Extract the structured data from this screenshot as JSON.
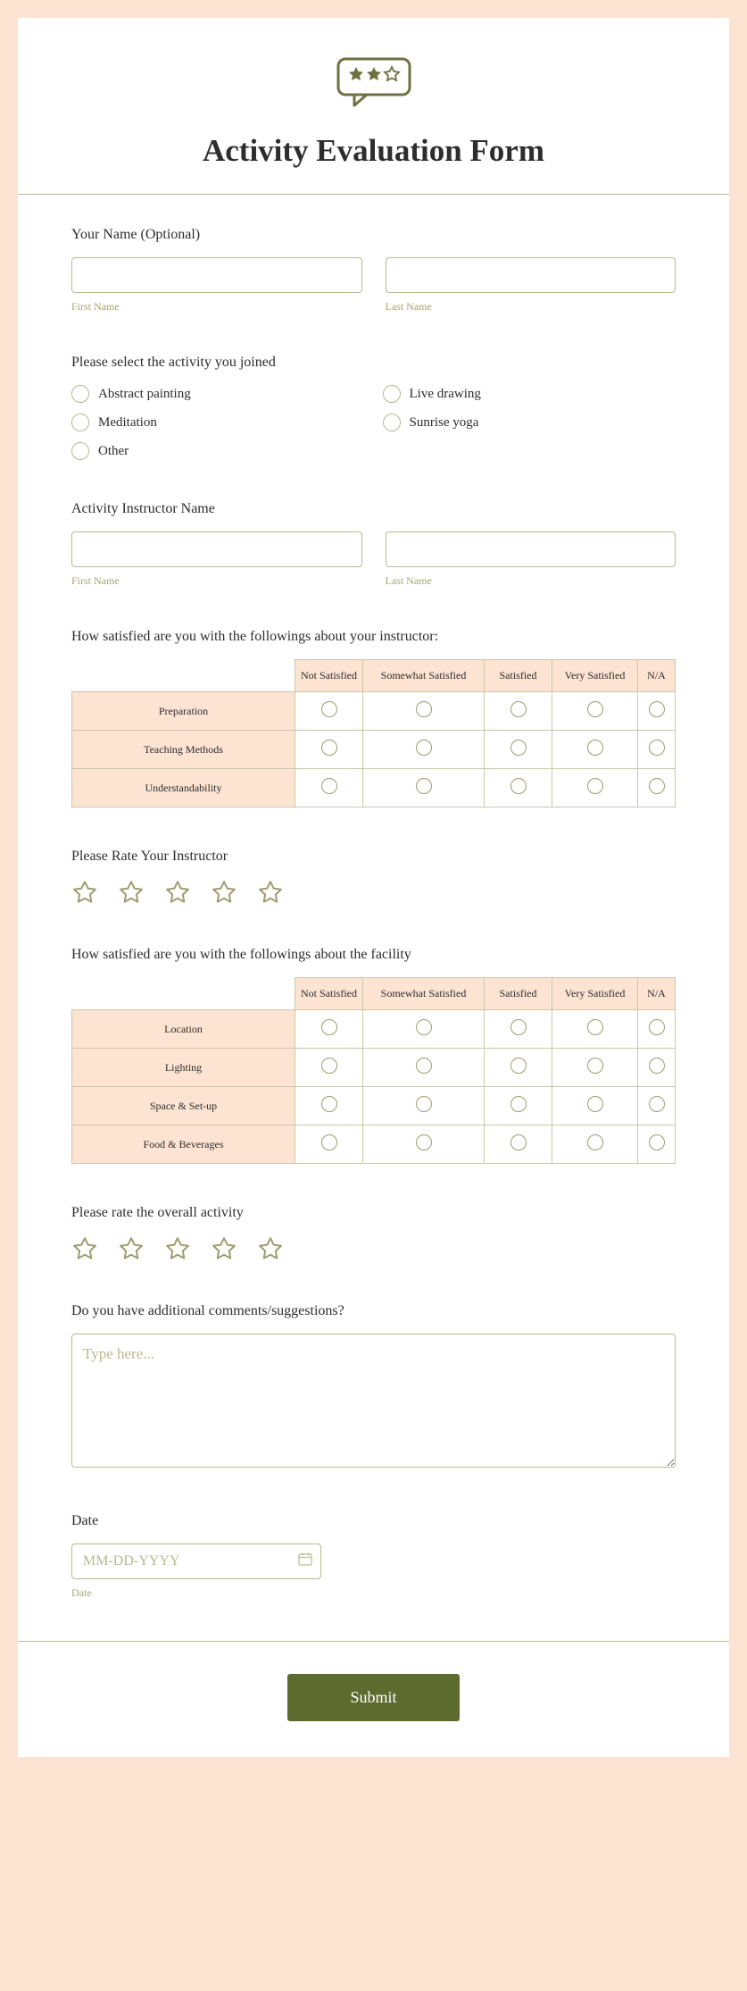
{
  "title": "Activity Evaluation Form",
  "your_name": {
    "label": "Your Name (Optional)",
    "first_sublabel": "First Name",
    "last_sublabel": "Last Name"
  },
  "activity_select": {
    "label": "Please select the activity you joined",
    "options": [
      "Abstract painting",
      "Live drawing",
      "Meditation",
      "Sunrise yoga",
      "Other"
    ]
  },
  "instructor_name": {
    "label": "Activity Instructor Name",
    "first_sublabel": "First Name",
    "last_sublabel": "Last Name"
  },
  "matrix1": {
    "label": "How satisfied are you with the followings about your instructor:",
    "cols": [
      "Not Satisfied",
      "Somewhat Satisfied",
      "Satisfied",
      "Very Satisfied",
      "N/A"
    ],
    "rows": [
      "Preparation",
      "Teaching Methods",
      "Understandability"
    ]
  },
  "rate_instructor_label": "Please Rate Your Instructor",
  "matrix2": {
    "label": "How satisfied are you with the followings about the facility",
    "cols": [
      "Not Satisfied",
      "Somewhat Satisfied",
      "Satisfied",
      "Very Satisfied",
      "N/A"
    ],
    "rows": [
      "Location",
      "Lighting",
      "Space & Set-up",
      "Food & Beverages"
    ]
  },
  "rate_activity_label": "Please rate the overall activity",
  "comments": {
    "label": "Do you have additional comments/suggestions?",
    "placeholder": "Type here..."
  },
  "date": {
    "label": "Date",
    "placeholder": "MM-DD-YYYY",
    "sublabel": "Date"
  },
  "submit_label": "Submit"
}
